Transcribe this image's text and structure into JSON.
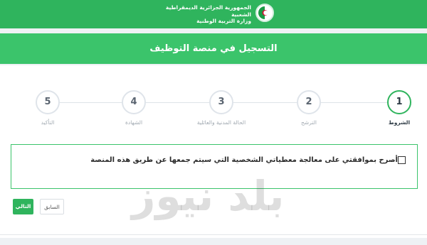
{
  "header": {
    "ministry_line1": "الجمهورية الجزائرية الديمقراطية الشعبية",
    "ministry_line2": "وزارة التربية الوطنية",
    "emblem_icon": "algeria-flag-emblem-icon",
    "bar_color": "#2fb45d"
  },
  "page": {
    "title": "التسجيل في منصة التوظيف"
  },
  "steps": [
    {
      "number": "1",
      "label": "الشروط",
      "active": true
    },
    {
      "number": "2",
      "label": "الترشح",
      "active": false
    },
    {
      "number": "3",
      "label": "الحالة المدنية والعائلية",
      "active": false
    },
    {
      "number": "4",
      "label": "الشهادة",
      "active": false
    },
    {
      "number": "5",
      "label": "التأكيد",
      "active": false
    }
  ],
  "terms": {
    "agree_text": "أصرح بموافقتي على معالجة معطياتي الشخصية التي سيتم جمعها عن طريق هذه المنصة",
    "checked": false
  },
  "buttons": {
    "next_label": "التالي",
    "previous_label": "السابق"
  },
  "watermark": {
    "text": "بلد نيوز"
  },
  "colors": {
    "accent": "#2fb45d",
    "title_bar": "#3bc46b"
  }
}
